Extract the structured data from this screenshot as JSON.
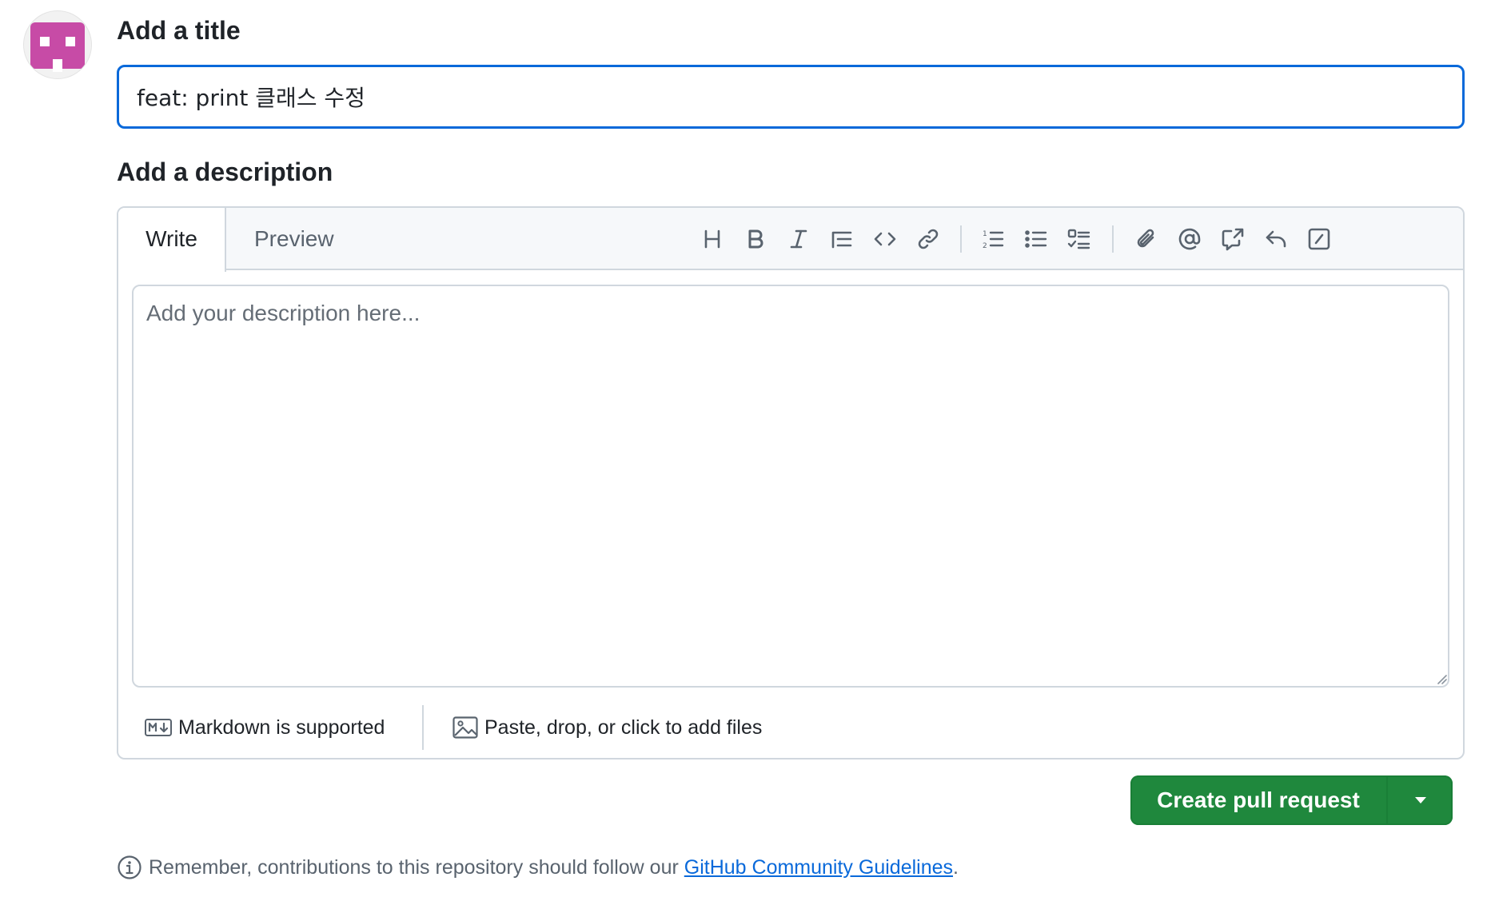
{
  "title_section": {
    "label": "Add a title",
    "value": "feat: print 클래스 수정"
  },
  "description_section": {
    "label": "Add a description",
    "placeholder": "Add your description here...",
    "tabs": {
      "write": "Write",
      "preview": "Preview"
    },
    "toolbar_icons": [
      "heading-icon",
      "bold-icon",
      "italic-icon",
      "quote-icon",
      "code-icon",
      "link-icon",
      "ordered-list-icon",
      "unordered-list-icon",
      "task-list-icon",
      "attach-icon",
      "mention-icon",
      "cross-reference-icon",
      "reply-icon",
      "slash-command-icon"
    ],
    "footer": {
      "markdown": "Markdown is supported",
      "attach": "Paste, drop, or click to add files"
    }
  },
  "actions": {
    "create_label": "Create pull request"
  },
  "guidelines": {
    "prefix": "Remember, contributions to this repository should follow our ",
    "link": "GitHub Community Guidelines",
    "suffix": "."
  },
  "colors": {
    "accent": "#0969da",
    "primary_button": "#1f883d",
    "avatar": "#c74ba6"
  }
}
